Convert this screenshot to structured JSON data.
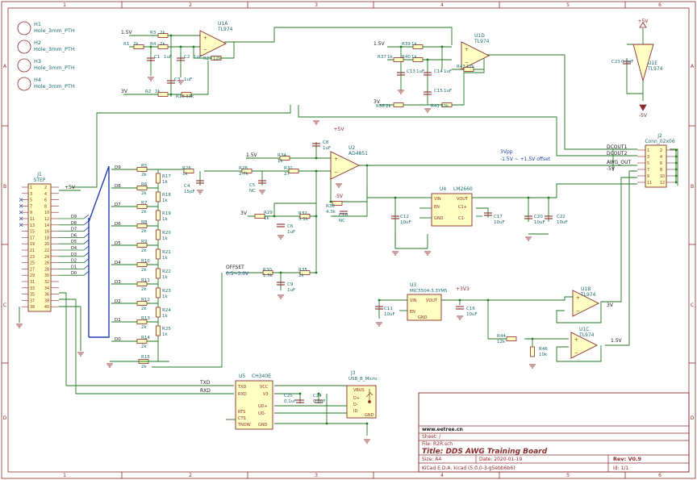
{
  "colors": {
    "frame": "#8c2a2a",
    "wire": "#1d7a1d",
    "part": "#8c2a2a",
    "part_fill": "#ffffc4",
    "label": "#1a1a1a",
    "ref": "#1a6b6b",
    "bus": "#1f3fae",
    "title": "#8c2a2a",
    "note": "#1f3fae"
  },
  "border": {
    "cols_top": [
      "1",
      "2",
      "3",
      "4",
      "5",
      "6"
    ],
    "cols_bottom": [
      "1",
      "2",
      "3",
      "4",
      "5",
      "6"
    ],
    "rows_left": [
      "A",
      "B",
      "C",
      "D"
    ],
    "rows_right": [
      "A",
      "B",
      "C",
      "D"
    ]
  },
  "holes": [
    {
      "ref": "H1",
      "value": "Hole_3mm_PTH"
    },
    {
      "ref": "H2",
      "value": "Hole_3mm_PTH"
    },
    {
      "ref": "H3",
      "value": "Hole_3mm_PTH"
    },
    {
      "ref": "H4",
      "value": "Hole_3mm_PTH"
    }
  ],
  "opamps": {
    "u1a": {
      "ref": "U1A",
      "value": "TL974"
    },
    "u1d": {
      "ref": "U1D",
      "value": "TL974"
    },
    "u1e": {
      "ref": "U1E",
      "value": "TL974"
    },
    "u1b": {
      "ref": "U1B",
      "value": "TL974"
    },
    "u1c": {
      "ref": "U1C",
      "value": "TL974"
    },
    "u2": {
      "ref": "U2",
      "value": "AD4851"
    }
  },
  "rail_labels": {
    "v15_a": "1.5V",
    "v15_b": "1.5V",
    "v15_c": "1.5V",
    "v3_a": "3V",
    "v3_b": "3V",
    "v3_c": "3V",
    "p5v_a": "+5V",
    "p5v_b": "+5V",
    "m5v_a": "-5V",
    "m5v_b": "-5V",
    "p3v3": "+3V3",
    "gnd": "GND",
    "u1b_out": "3V",
    "u1c_out": "1.5V"
  },
  "passives_top": [
    {
      "ref": "R1",
      "val": "2k"
    },
    {
      "ref": "R2",
      "val": "2k"
    },
    {
      "ref": "R3",
      "val": "2k"
    },
    {
      "ref": "R4",
      "val": "2k"
    },
    {
      "ref": "R27",
      "val": "12k"
    },
    {
      "ref": "R18",
      "val": "33k"
    },
    {
      "ref": "C1",
      "val": "1uF"
    },
    {
      "ref": "C2",
      "val": "1uF"
    },
    {
      "ref": "C3",
      "val": "1uF"
    },
    {
      "ref": "R39",
      "val": "1k"
    },
    {
      "ref": "R37",
      "val": "1k"
    },
    {
      "ref": "R40",
      "val": "1k"
    },
    {
      "ref": "R38",
      "val": "2k"
    },
    {
      "ref": "R41",
      "val": "33k"
    },
    {
      "ref": "R43",
      "val": "12k"
    },
    {
      "ref": "C13",
      "val": "1uF"
    },
    {
      "ref": "C14",
      "val": "1uF"
    },
    {
      "ref": "C15",
      "val": "1uF"
    },
    {
      "ref": "C23",
      "val": "0.1uF"
    }
  ],
  "passives_mid": [
    {
      "ref": "R26",
      "val": "1k"
    },
    {
      "ref": "C4",
      "val": "15pF"
    },
    {
      "ref": "R28",
      "val": "2.7k"
    },
    {
      "ref": "R31",
      "val": "27"
    },
    {
      "ref": "C5",
      "val": "NC"
    },
    {
      "ref": "R34",
      "val": "1k"
    },
    {
      "ref": "C8",
      "val": "1uF"
    },
    {
      "ref": "R36",
      "val": "4.3k"
    },
    {
      "ref": "C10",
      "val": "NC"
    },
    {
      "ref": "R29",
      "val": "1k"
    },
    {
      "ref": "R32",
      "val": "5.1k"
    },
    {
      "ref": "C6",
      "val": "1uF"
    },
    {
      "ref": "R30",
      "val": "1.5k"
    },
    {
      "ref": "R35",
      "val": "2k"
    },
    {
      "ref": "C9",
      "val": "1uF"
    },
    {
      "ref": "C11",
      "val": "10uF"
    },
    {
      "ref": "C16",
      "val": "10uF"
    },
    {
      "ref": "R44",
      "val": "12k"
    },
    {
      "ref": "R46",
      "val": "10k"
    },
    {
      "ref": "C12",
      "val": "10uF"
    },
    {
      "ref": "C17",
      "val": "10uF"
    },
    {
      "ref": "C20",
      "val": "10uF"
    },
    {
      "ref": "C22",
      "val": "10uF"
    },
    {
      "ref": "C25",
      "val": "0.1uF"
    },
    {
      "ref": "C24",
      "val": "0.1uF"
    }
  ],
  "ladder": {
    "bits": [
      "D9",
      "D8",
      "D7",
      "D6",
      "D5",
      "D4",
      "D3",
      "D2",
      "D1",
      "D0"
    ],
    "series": [
      {
        "ref": "R5",
        "val": "2k"
      },
      {
        "ref": "R6",
        "val": "2k"
      },
      {
        "ref": "R7",
        "val": "2k"
      },
      {
        "ref": "R8",
        "val": "2k"
      },
      {
        "ref": "R9",
        "val": "2k"
      },
      {
        "ref": "R10",
        "val": "2k"
      },
      {
        "ref": "R11",
        "val": "2k"
      },
      {
        "ref": "R12",
        "val": "2k"
      },
      {
        "ref": "R13",
        "val": "2k"
      },
      {
        "ref": "R14",
        "val": "2k"
      }
    ],
    "shunt": [
      {
        "ref": "R17",
        "val": "1k"
      },
      {
        "ref": "R18",
        "val": "1k"
      },
      {
        "ref": "R19",
        "val": "1k"
      },
      {
        "ref": "R20",
        "val": "1k"
      },
      {
        "ref": "R21",
        "val": "1k"
      },
      {
        "ref": "R22",
        "val": "1k"
      },
      {
        "ref": "R23",
        "val": "1k"
      },
      {
        "ref": "R24",
        "val": "1k"
      },
      {
        "ref": "R25",
        "val": "1k"
      }
    ],
    "term": {
      "ref": "R15",
      "val": "2k"
    }
  },
  "step": {
    "ref": "J1",
    "value": "STEP",
    "left_pins": [
      "1",
      "3",
      "5",
      "7",
      "9",
      "11",
      "13",
      "15",
      "17",
      "19",
      "21",
      "23",
      "25",
      "27",
      "29",
      "31",
      "33",
      "35",
      "37",
      "39"
    ],
    "right_pins": [
      "2",
      "4",
      "6",
      "8",
      "10",
      "12",
      "14",
      "16",
      "18",
      "20",
      "22",
      "24",
      "26",
      "28",
      "30",
      "32",
      "34",
      "36",
      "38",
      "40"
    ],
    "nets": [
      "+5V",
      "D9",
      "D8",
      "D7",
      "D6",
      "D5",
      "D4",
      "D3",
      "D2",
      "D1",
      "D0"
    ]
  },
  "ics": {
    "u4": {
      "ref": "U4",
      "value": "LM2660",
      "pins": [
        "VIN",
        "EN",
        "GND",
        "VOUT",
        "C1+",
        "C1-"
      ]
    },
    "u3": {
      "ref": "U3",
      "value": "MIC5504-3.3YM5",
      "pins": [
        "VIN",
        "EN",
        "GND",
        "VOUT"
      ]
    },
    "u5": {
      "ref": "U5",
      "value": "CH340E",
      "pins": [
        "TXD",
        "RXD",
        "RTS",
        "CTS",
        "TNOW",
        "VCC",
        "V3",
        "UD+",
        "UD-",
        "GND"
      ]
    },
    "j3": {
      "ref": "J3",
      "value": "USB_B_Micro",
      "pins": [
        "VBUS",
        "D+",
        "D-",
        "ID",
        "GND"
      ]
    }
  },
  "conn_j2": {
    "ref": "J2",
    "value": "Conn_02x06",
    "pins_left": [
      "1",
      "3",
      "5",
      "7",
      "9",
      "11"
    ],
    "pins_right": [
      "2",
      "4",
      "6",
      "8",
      "10",
      "12"
    ],
    "nets": [
      "DCOUT1",
      "DCOUT2",
      "AWG_OUT",
      "-5V"
    ]
  },
  "net_labels": {
    "offset": "OFFSET",
    "offset_range": "0.5~3.0V",
    "txd": "TXD",
    "rxd": "RXD",
    "note_vpp": "3Vpp",
    "note_range": "-1.5V ~ +1.5V offset"
  },
  "title_block": {
    "site": "www.eetree.cn",
    "sheet": "Sheet: /",
    "file": "File: R2R.sch",
    "title": "Title: DDS AWG Training Board",
    "size": "Size: A4",
    "date": "Date: 2020-01-19",
    "rev": "Rev: V0.9",
    "tool": "KiCad E.D.A.  kicad (5.0.0-3-g5ebb6b6)",
    "id": "Id: 1/1"
  }
}
